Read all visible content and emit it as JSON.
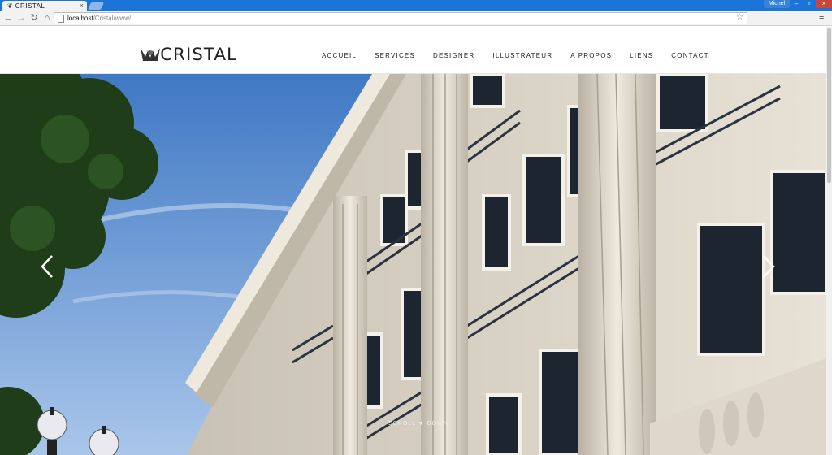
{
  "browser": {
    "tab_title": "CRISTAL",
    "tab_icon": "site-favicon-icon",
    "user_name": "Michel",
    "url_host": "localhost",
    "url_path": "/Cristal/www/"
  },
  "site": {
    "logo_text": "CRISTAL",
    "menu": [
      {
        "label": "ACCUEIL"
      },
      {
        "label": "SERVICES"
      },
      {
        "label": "DESIGNER"
      },
      {
        "label": "ILLUSTRATEUR"
      },
      {
        "label": "A PROPOS"
      },
      {
        "label": "LIENS"
      },
      {
        "label": "CONTACT"
      }
    ],
    "scroll_hint": "SCROLL ▼ DOWN"
  },
  "colors": {
    "tabstrip": "#1b74d8",
    "sky": "#5d8fcf",
    "stone": "#d9d2c3"
  }
}
